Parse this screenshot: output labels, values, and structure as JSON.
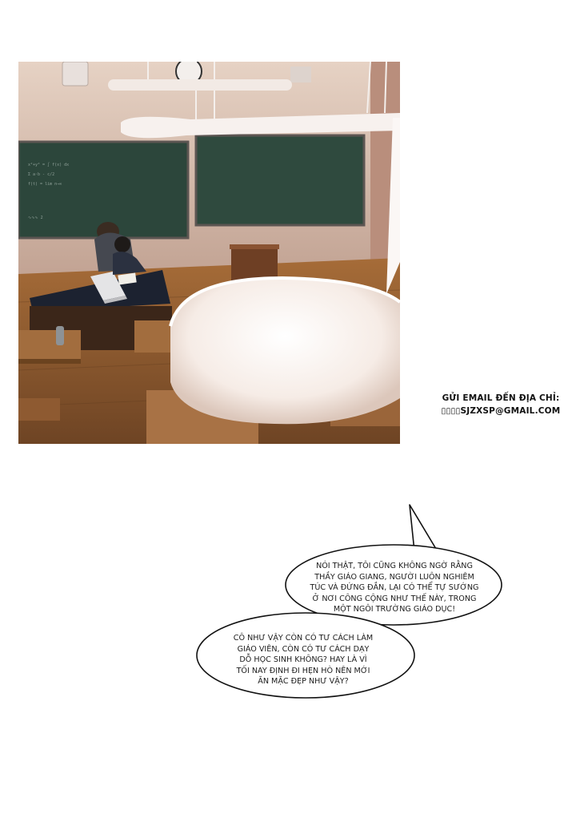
{
  "email_notice": {
    "line1": "GỬI EMAIL ĐẾN ĐỊA CHỈ:",
    "line2": "▯▯▯▯SJZXSP@GMAIL.COM"
  },
  "bubbles": [
    {
      "lines": [
        "NÓI THẬT, TÔI CŨNG KHÔNG NGỜ RẰNG",
        "THẦY GIÁO GIANG, NGƯỜI LUÔN NGHIÊM",
        "TÚC VÀ ĐỨNG ĐẮN, LẠI CÓ THỂ TỰ SƯỚNG",
        "Ở NƠI CÔNG CỘNG NHƯ THẾ NÀY, TRONG",
        "MỘT NGÔI TRƯỜNG GIÁO DỤC!"
      ]
    },
    {
      "lines": [
        "CÔ NHƯ VẬY CÒN CÓ TƯ CÁCH LÀM",
        "GIÁO VIÊN, CÒN CÓ TƯ CÁCH DẠY",
        "DỖ HỌC SINH KHÔNG? HAY LÀ VÌ",
        "TỐI NAY ĐỊNH ĐI HẸN HÒ NÊN MỚI",
        "ĂN MẶC ĐẸP NHƯ VẬY?"
      ]
    }
  ],
  "colors": {
    "wall": "#cdb3a3",
    "chalkboard": "#2f4a3e",
    "floor": "#8a5a30",
    "desk": "#1c2230",
    "lamp": "#f6f0ec"
  }
}
